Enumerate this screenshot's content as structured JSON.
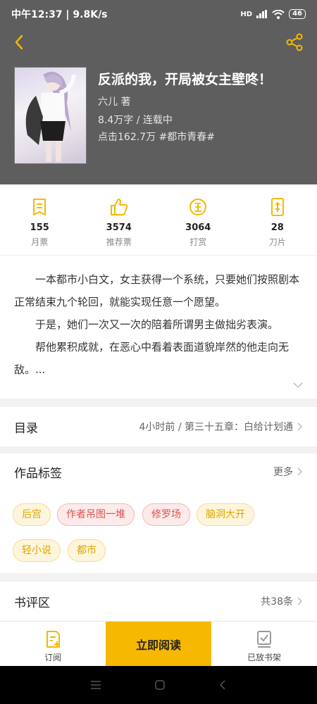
{
  "status": {
    "time_speed": "中午12:37 | 9.8K/s",
    "network": "HD",
    "battery": "46"
  },
  "book": {
    "title": "反派的我，开局被女主壁咚！",
    "author": "六儿  著",
    "words_status": "8.4万字 / 连载中",
    "clicks_category": "点击162.7万  #都市青春#"
  },
  "stats": [
    {
      "value": "155",
      "label": "月票",
      "icon": "monthly-ticket-icon"
    },
    {
      "value": "3574",
      "label": "推荐票",
      "icon": "thumbs-up-icon"
    },
    {
      "value": "3064",
      "label": "打赏",
      "icon": "reward-coin-icon"
    },
    {
      "value": "28",
      "label": "刀片",
      "icon": "blade-icon"
    }
  ],
  "synopsis": {
    "p1": "一本都市小白文，女主获得一个系统，只要她们按照剧本正常结束九个轮回，就能实现任意一个愿望。",
    "p2": "于是，她们一次又一次的陪着所谓男主做拙劣表演。",
    "p3": "帮他累积成就，在恶心中看着表面道貌岸然的他走向无敌。..."
  },
  "toc": {
    "title": "目录",
    "latest": "4小时前 / 第三十五章：白给计划通"
  },
  "tags_section": {
    "title": "作品标签",
    "more": "更多"
  },
  "tags": [
    "后宫",
    "作者吊图一堆",
    "修罗场",
    "脑洞大开",
    "轻小说",
    "都市"
  ],
  "reviews": {
    "title": "书评区",
    "count": "共38条"
  },
  "bottom": {
    "subscribe": "订阅",
    "read_now": "立即阅读",
    "on_shelf": "已放书架"
  },
  "colors": {
    "accent": "#f6b800",
    "header_bg": "#5e5e5e",
    "tag_yellow": "#e0a400",
    "tag_red": "#d9534f"
  }
}
